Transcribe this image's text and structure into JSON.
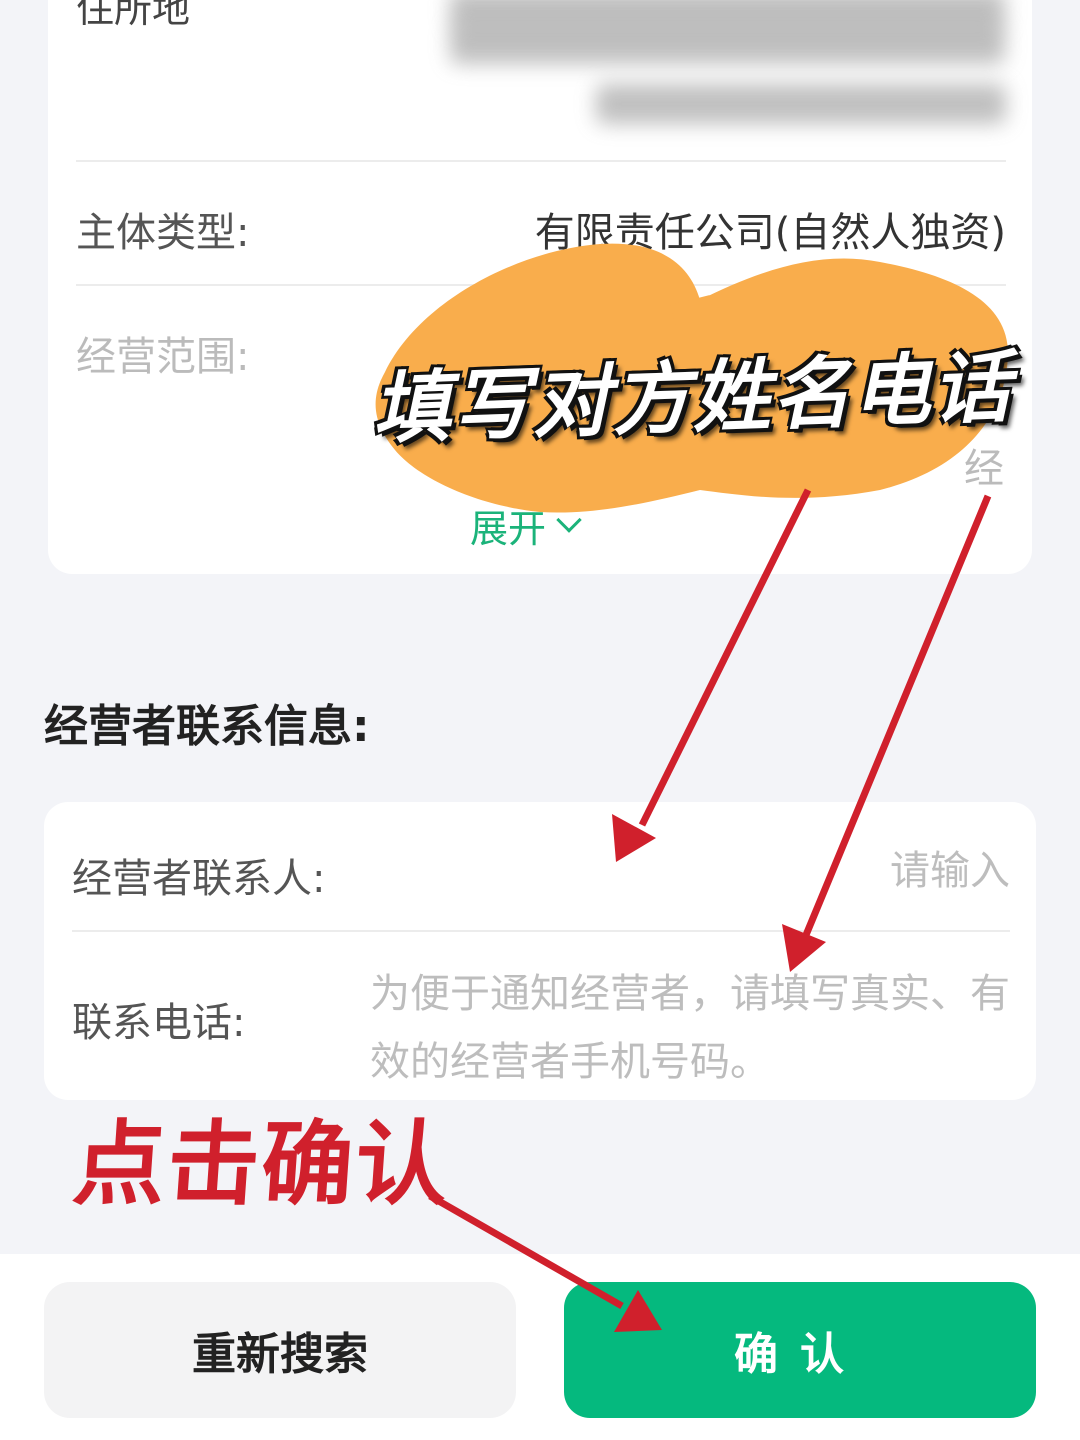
{
  "business_info": {
    "address_label": "住所地",
    "entity_type_label": "主体类型:",
    "entity_type_value": "有限责任公司(自然人独资)",
    "scope_label": "经营范围:",
    "scope_value_tail": "经",
    "expand_label": "展开"
  },
  "contact_section": {
    "title": "经营者联系信息:",
    "contact_person_label": "经营者联系人:",
    "contact_person_placeholder": "请输入",
    "phone_label": "联系电话:",
    "phone_placeholder": "为便于通知经营者，请填写真实、有效的经营者手机号码。"
  },
  "actions": {
    "research_label": "重新搜索",
    "confirm_label": "确认"
  },
  "annotations": {
    "fill_in_text": "填写对方姓名电话",
    "click_confirm_text": "点击确认"
  },
  "colors": {
    "accent_green": "#05b97e",
    "expand_green": "#1bb37a",
    "annotation_red": "#d0202c",
    "highlight_orange": "#f9ad4c"
  }
}
